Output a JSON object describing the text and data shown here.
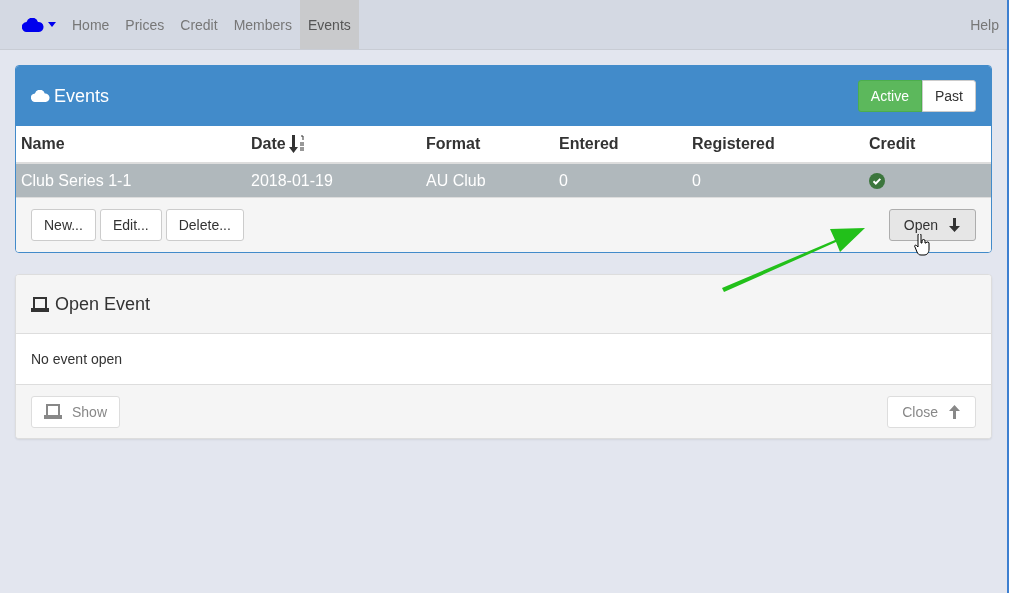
{
  "navbar": {
    "items": [
      {
        "label": "Home",
        "selected": false
      },
      {
        "label": "Prices",
        "selected": false
      },
      {
        "label": "Credit",
        "selected": false
      },
      {
        "label": "Members",
        "selected": false
      },
      {
        "label": "Events",
        "selected": true
      }
    ],
    "help": "Help"
  },
  "events_panel": {
    "title": "Events",
    "filters": [
      {
        "label": "Active",
        "selected": true
      },
      {
        "label": "Past",
        "selected": false
      }
    ],
    "columns": [
      {
        "label": "Name",
        "sorted": false
      },
      {
        "label": "Date",
        "sorted": true
      },
      {
        "label": "Format",
        "sorted": false
      },
      {
        "label": "Entered",
        "sorted": false
      },
      {
        "label": "Registered",
        "sorted": false
      },
      {
        "label": "Credit",
        "sorted": false
      }
    ],
    "rows": [
      {
        "name": "Club Series 1-1",
        "date": "2018-01-19",
        "format": "AU Club",
        "entered": "0",
        "registered": "0",
        "credit": true,
        "selected": true
      }
    ],
    "buttons": [
      "New...",
      "Edit...",
      "Delete..."
    ],
    "open_button": {
      "label": "Open",
      "disabled": false
    }
  },
  "open_event_panel": {
    "title": "Open Event",
    "message": "No event open",
    "show_button": {
      "label": "Show",
      "disabled": true
    },
    "close_button": {
      "label": "Close",
      "disabled": true
    }
  }
}
